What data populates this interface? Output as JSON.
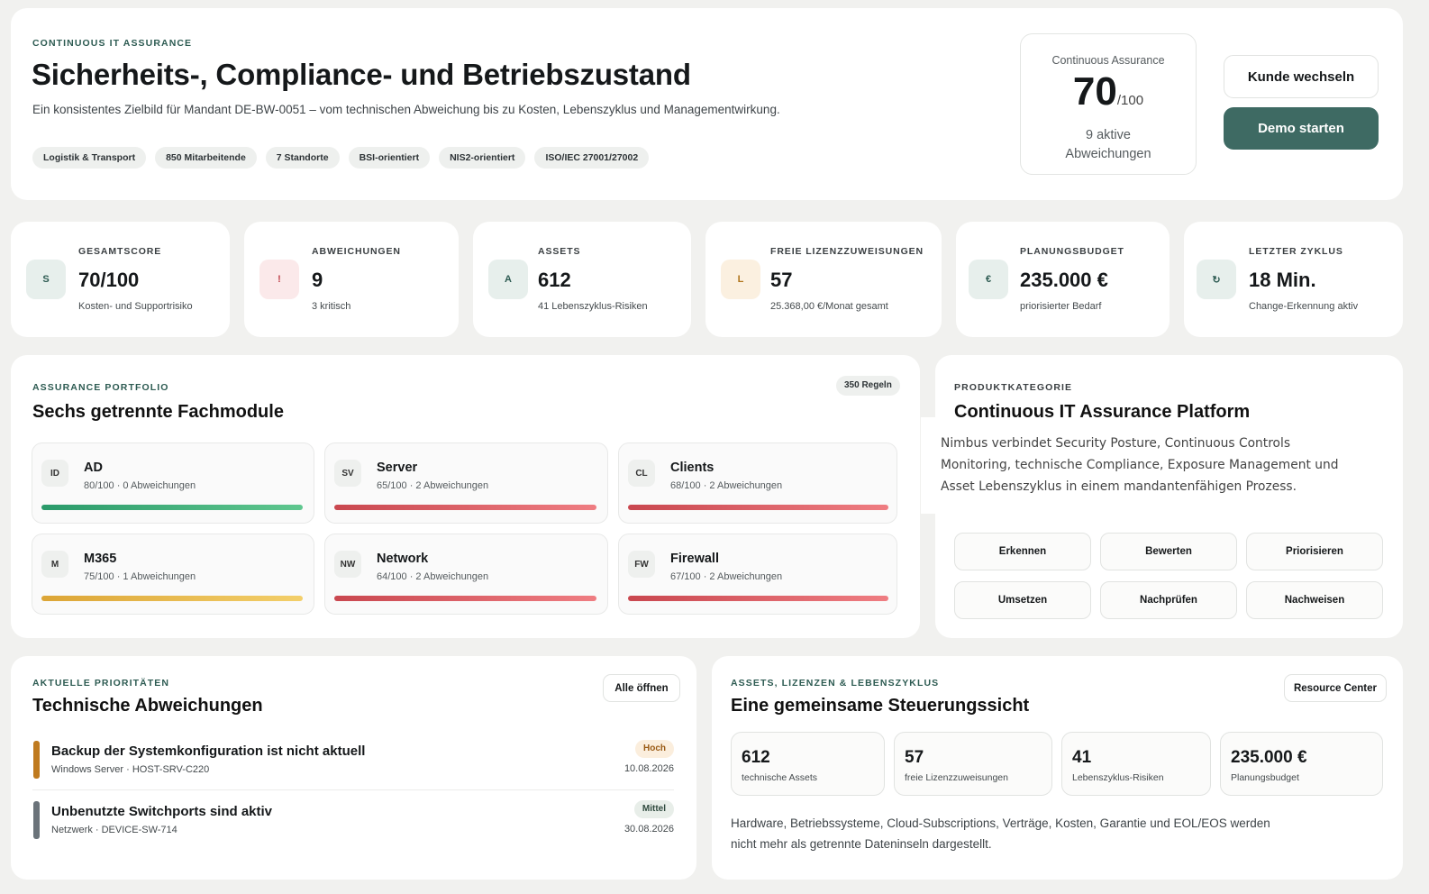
{
  "header": {
    "eyebrow": "CONTINUOUS IT ASSURANCE",
    "title": "Sicherheits-, Compliance- und Betriebszustand",
    "subtitle": "Ein konsistentes Zielbild für Mandant DE-BW-0051 – vom technischen Abweichung bis zu Kosten, Lebenszyklus und Managementwirkung.",
    "tags": [
      "Logistik & Transport",
      "850 Mitarbeitende",
      "7 Standorte",
      "BSI-orientiert",
      "NIS2-orientiert",
      "ISO/IEC 27001/27002"
    ],
    "assurance": {
      "label": "Continuous Assurance",
      "score": "70",
      "max": "/100",
      "sub_line1": "9 aktive",
      "sub_line2": "Abweichungen"
    },
    "switch_button": "Kunde wechseln",
    "demo_button": "Demo starten"
  },
  "kpis": [
    {
      "icon": "S",
      "label": "GESAMTSCORE",
      "value": "70/100",
      "sub": "Kosten- und Supportrisiko"
    },
    {
      "icon": "!",
      "label": "ABWEICHUNGEN",
      "value": "9",
      "sub": "3 kritisch"
    },
    {
      "icon": "A",
      "label": "ASSETS",
      "value": "612",
      "sub": "41 Lebenszyklus-Risiken"
    },
    {
      "icon": "L",
      "label": "FREIE LIZENZZUWEISUNGEN",
      "value": "57",
      "sub": "25.368,00 €/Monat gesamt"
    },
    {
      "icon": "€",
      "label": "PLANUNGSBUDGET",
      "value": "235.000 €",
      "sub": "priorisierter Bedarf"
    },
    {
      "icon": "↻",
      "label": "LETZTER ZYKLUS",
      "value": "18 Min.",
      "sub": "Change-Erkennung aktiv"
    }
  ],
  "portfolio": {
    "eyebrow": "ASSURANCE PORTFOLIO",
    "title": "Sechs getrennte Fachmodule",
    "badge": "350 Regeln",
    "modules": [
      {
        "code": "ID",
        "name": "AD",
        "sub": "80/100 · 0 Abweichungen",
        "score": 80
      },
      {
        "code": "SV",
        "name": "Server",
        "sub": "65/100 · 2 Abweichungen",
        "score": 65
      },
      {
        "code": "CL",
        "name": "Clients",
        "sub": "68/100 · 2 Abweichungen",
        "score": 68
      },
      {
        "code": "M",
        "name": "M365",
        "sub": "75/100 · 1 Abweichungen",
        "score": 75
      },
      {
        "code": "NW",
        "name": "Network",
        "sub": "64/100 · 2 Abweichungen",
        "score": 64
      },
      {
        "code": "FW",
        "name": "Firewall",
        "sub": "67/100 · 2 Abweichungen",
        "score": 67
      }
    ]
  },
  "product": {
    "eyebrow": "PRODUKTKATEGORIE",
    "title": "Continuous IT Assurance Platform",
    "tooltip": "Nimbus verbindet Security Posture, Continuous Controls Monitoring, technische Compliance, Exposure Management und Asset Lebenszyklus in einem mandantenfähigen Prozess.",
    "steps": [
      "Erkennen",
      "Bewerten",
      "Priorisieren",
      "Umsetzen",
      "Nachprüfen",
      "Nachweisen"
    ]
  },
  "priorities": {
    "eyebrow": "AKTUELLE PRIORITÄTEN",
    "title": "Technische Abweichungen",
    "open_all": "Alle öffnen",
    "items": [
      {
        "title": "Backup der Systemkonfiguration ist nicht aktuell",
        "sub": "Windows Server · HOST-SRV-C220",
        "badge": "Hoch",
        "date": "10.08.2026"
      },
      {
        "title": "Unbenutzte Switchports sind aktiv",
        "sub": "Netzwerk · DEVICE-SW-714",
        "badge": "Mittel",
        "date": "30.08.2026"
      }
    ]
  },
  "resources": {
    "eyebrow": "ASSETS, LIZENZEN & LEBENSZYKLUS",
    "title": "Eine gemeinsame Steuerungssicht",
    "button": "Resource Center",
    "stats": [
      {
        "value": "612",
        "label": "technische Assets"
      },
      {
        "value": "57",
        "label": "freie Lizenzzuweisungen"
      },
      {
        "value": "41",
        "label": "Lebenszyklus-Risiken"
      },
      {
        "value": "235.000 €",
        "label": "Planungsbudget"
      }
    ],
    "text": "Hardware, Betriebssysteme, Cloud-Subscriptions, Verträge, Kosten, Garantie und EOL/EOS werden nicht mehr als getrennte Dateninseln dargestellt."
  },
  "colors": {
    "accent": "#3e6a63",
    "good_bar": "#3aa877",
    "warn_bar": "#e5b43c",
    "bad_bar": "#d85c63",
    "prio_high": "#bf7a1f",
    "prio_medium": "#6b737a"
  }
}
